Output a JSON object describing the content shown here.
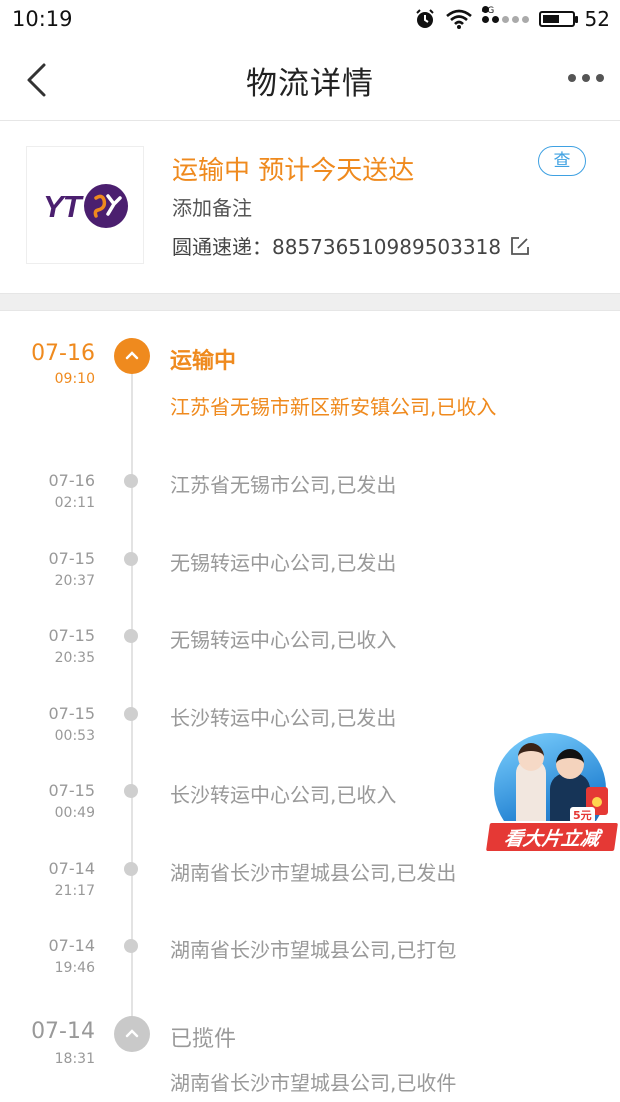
{
  "status_bar": {
    "time": "10:19",
    "network": "4G",
    "battery": "52",
    "battery_fraction": 0.52
  },
  "header": {
    "title": "物流详情",
    "icons": [
      "back-arrow-icon",
      "more-dots-icon"
    ]
  },
  "package": {
    "logo_text": "YT",
    "status": "运输中 预计今天送达",
    "remark_label": "添加备注",
    "carrier_tracking": "圆通速递：885736510989503318",
    "check_label": "查"
  },
  "colors": {
    "accent": "#ef8a1e",
    "link_blue": "#3fa1e2",
    "logo_purple": "#4b1f6f",
    "muted": "#999999"
  },
  "timeline": {
    "first": {
      "date": "07-16",
      "time": "09:10",
      "title": "运输中",
      "desc": "江苏省无锡市新区新安镇公司,已收入"
    },
    "events": [
      {
        "date": "07-16",
        "time": "02:11",
        "desc": "江苏省无锡市公司,已发出"
      },
      {
        "date": "07-15",
        "time": "20:37",
        "desc": "无锡转运中心公司,已发出"
      },
      {
        "date": "07-15",
        "time": "20:35",
        "desc": "无锡转运中心公司,已收入"
      },
      {
        "date": "07-15",
        "time": "00:53",
        "desc": "长沙转运中心公司,已发出"
      },
      {
        "date": "07-15",
        "time": "00:49",
        "desc": "长沙转运中心公司,已收入"
      },
      {
        "date": "07-14",
        "time": "21:17",
        "desc": "湖南省长沙市望城县公司,已发出"
      },
      {
        "date": "07-14",
        "time": "19:46",
        "desc": "湖南省长沙市望城县公司,已打包"
      }
    ],
    "last": {
      "date": "07-14",
      "time": "18:31",
      "title": "已揽件",
      "desc": "湖南省长沙市望城县公司,已收件"
    }
  },
  "promo": {
    "label": "看大片立减",
    "amount": "5元"
  }
}
